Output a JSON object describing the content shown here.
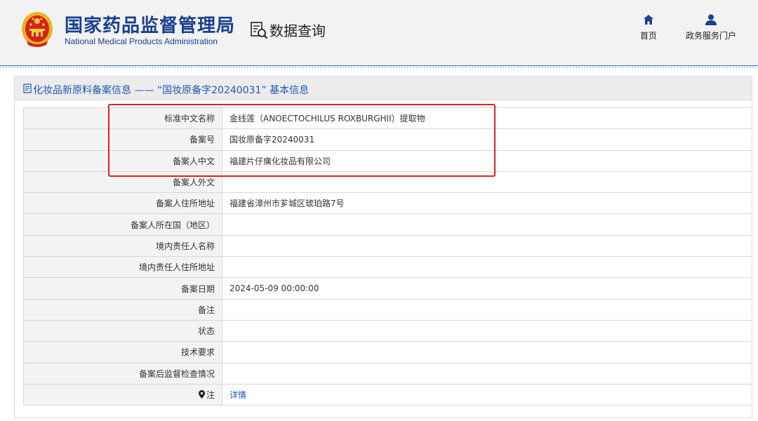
{
  "header": {
    "org_name_cn": "国家药品监督管理局",
    "org_name_en": "National Medical Products Administration",
    "section_title": "数据查询",
    "nav": [
      {
        "label": "首页",
        "icon": "home-icon"
      },
      {
        "label": "政务服务门户",
        "icon": "user-icon"
      }
    ]
  },
  "panel": {
    "title": "化妆品新原料备案信息 —— “国妆原备字20240031” 基本信息",
    "title_icon": "document-icon"
  },
  "table": {
    "rows": [
      {
        "label": "标准中文名称",
        "value": "金线莲（ANOECTOCHILUS ROXBURGHII）提取物"
      },
      {
        "label": "备案号",
        "value": "国妆原备字20240031"
      },
      {
        "label": "备案人中文",
        "value": "福建片仔癀化妆品有限公司"
      },
      {
        "label": "备案人外文",
        "value": ""
      },
      {
        "label": "备案人住所地址",
        "value": "福建省漳州市芗城区琥珀路7号"
      },
      {
        "label": "备案人所在国（地区）",
        "value": ""
      },
      {
        "label": "境内责任人名称",
        "value": ""
      },
      {
        "label": "境内责任人住所地址",
        "value": ""
      },
      {
        "label": "备案日期",
        "value": "2024-05-09 00:00:00"
      },
      {
        "label": "备注",
        "value": ""
      },
      {
        "label": "状态",
        "value": ""
      },
      {
        "label": "技术要求",
        "value": ""
      },
      {
        "label": "备案后监督检查情况",
        "value": ""
      }
    ],
    "note_row": {
      "label": "注",
      "link": "详情",
      "icon": "pin-icon"
    }
  },
  "colors": {
    "brand_blue": "#1a3f8f",
    "link_blue": "#1d57b6",
    "highlight_red": "#e02020"
  }
}
